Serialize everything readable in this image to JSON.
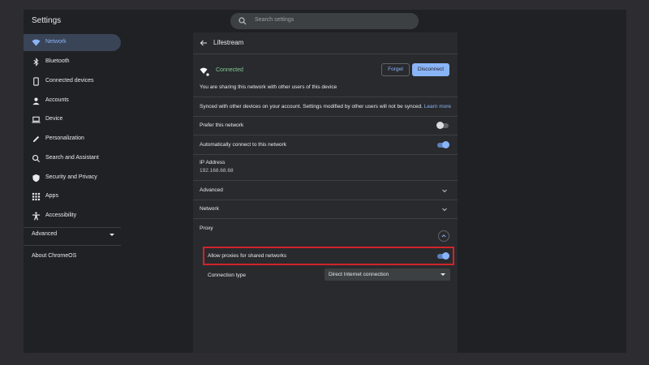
{
  "app": {
    "title": "Settings"
  },
  "search": {
    "placeholder": "Search settings"
  },
  "sidebar": {
    "items": [
      {
        "label": "Network",
        "icon": "wifi-icon",
        "active": true
      },
      {
        "label": "Bluetooth",
        "icon": "bluetooth-icon"
      },
      {
        "label": "Connected devices",
        "icon": "phone-icon"
      },
      {
        "label": "Accounts",
        "icon": "person-icon"
      },
      {
        "label": "Device",
        "icon": "laptop-icon"
      },
      {
        "label": "Personalization",
        "icon": "pen-icon"
      },
      {
        "label": "Search and Assistant",
        "icon": "search-icon"
      },
      {
        "label": "Security and Privacy",
        "icon": "shield-icon"
      },
      {
        "label": "Apps",
        "icon": "apps-grid-icon"
      },
      {
        "label": "Accessibility",
        "icon": "accessibility-icon"
      }
    ],
    "advanced_label": "Advanced",
    "about_label": "About ChromeOS"
  },
  "main": {
    "title": "Lifestream",
    "status": "Connected",
    "forget_label": "Forget",
    "disconnect_label": "Disconnect",
    "sharing_text": "You are sharing this network with other users of this device",
    "synced_text": "Synced with other devices on your account. Settings modified by other users will not be synced.",
    "learn_more": "Learn more",
    "prefer_label": "Prefer this network",
    "prefer_on": false,
    "auto_connect_label": "Automatically connect to this network",
    "auto_connect_on": true,
    "ip_label": "IP Address",
    "ip_value": "192.168.68.68",
    "advanced_label": "Advanced",
    "network_label": "Network",
    "proxy_label": "Proxy",
    "allow_proxies_label": "Allow proxies for shared networks",
    "allow_proxies_on": true,
    "connection_type_label": "Connection type",
    "connection_type_value": "Direct Internet connection"
  },
  "colors": {
    "accent": "#8ab4f8",
    "connected": "#81c995",
    "highlight": "#d1242a",
    "background": "#202124",
    "panel": "#292a2d"
  }
}
